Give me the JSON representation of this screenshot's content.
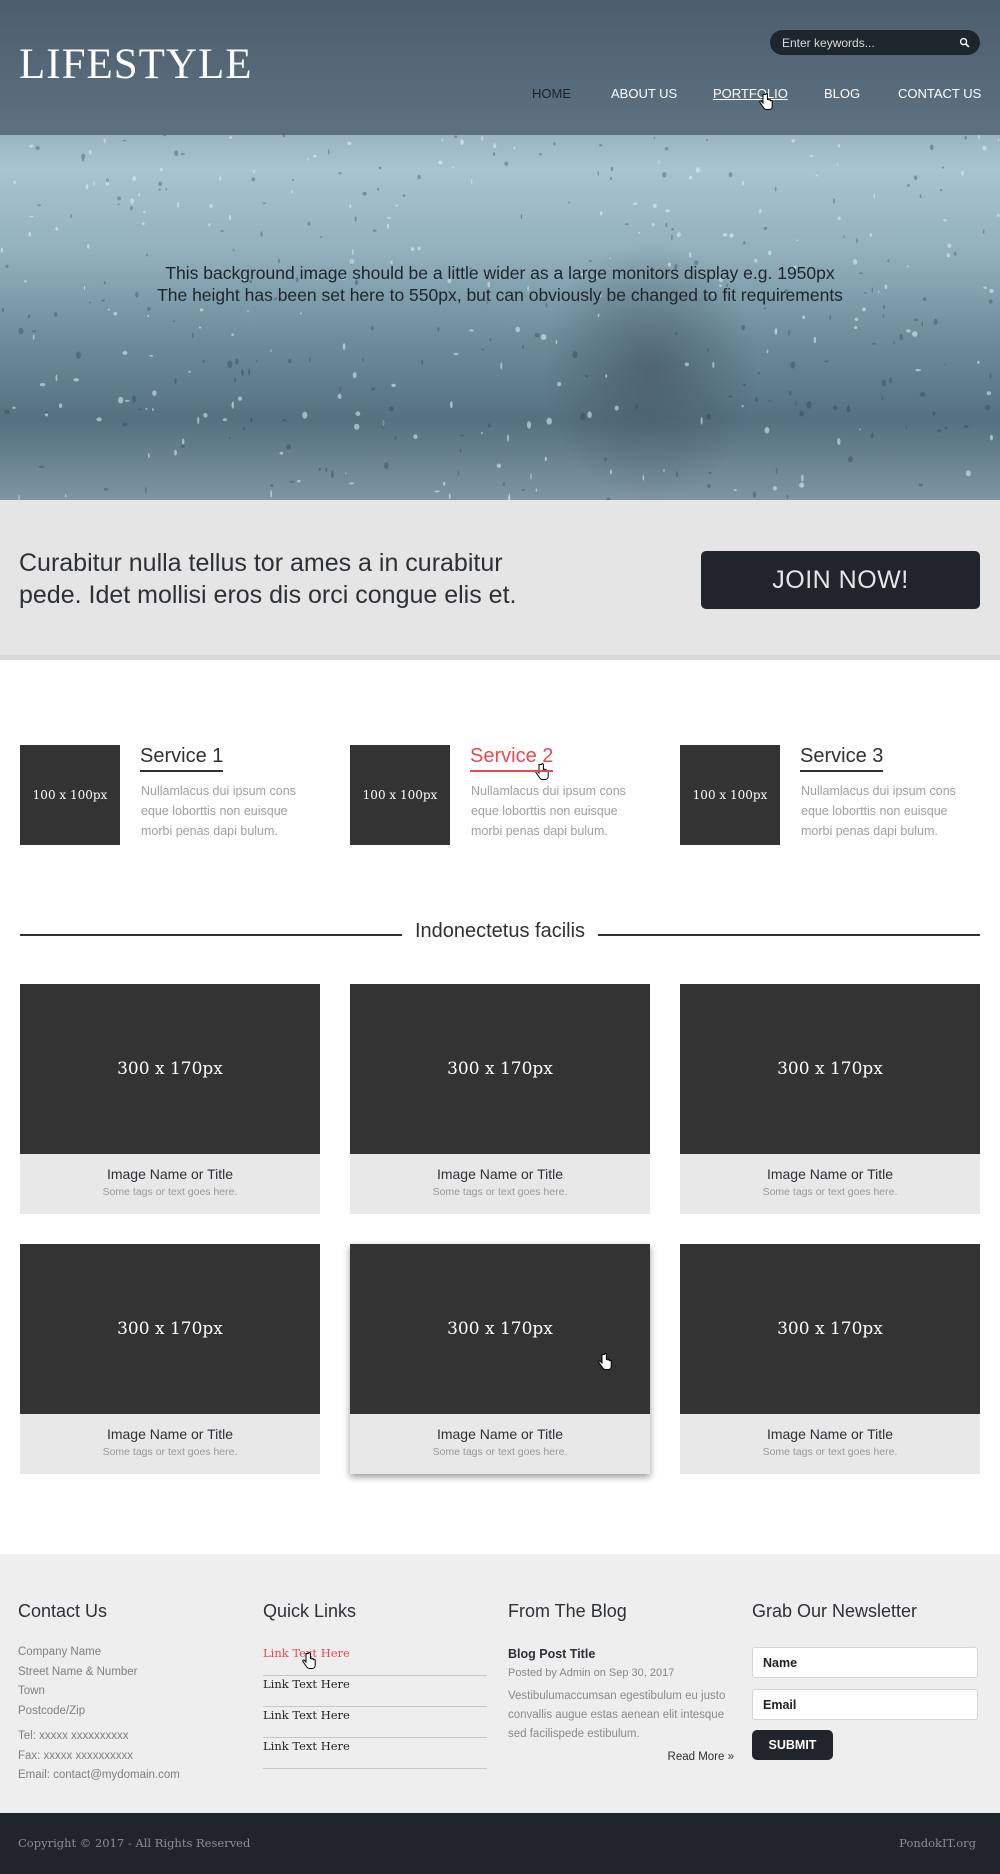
{
  "header": {
    "logo": "LIFESTYLE",
    "search_placeholder": "Enter keywords...",
    "nav": [
      "HOME",
      "ABOUT US",
      "PORTFOLIO",
      "BLOG",
      "CONTACT US"
    ]
  },
  "hero": {
    "line1": "This background image should be a little wider as a large monitors display e.g. 1950px",
    "line2": "The height has been set here to 550px, but can obviously be changed to fit requirements"
  },
  "cta": {
    "text": "Curabitur nulla tellus tor ames a in curabitur pede. Idet mollisi eros dis orci congue elis et.",
    "button": "JOIN NOW!"
  },
  "services": [
    {
      "thumb": "100 x 100px",
      "title": "Service 1",
      "desc": "Nullamlacus dui ipsum cons eque loborttis non euisque morbi penas dapi bulum."
    },
    {
      "thumb": "100 x 100px",
      "title": "Service 2",
      "desc": "Nullamlacus dui ipsum cons eque loborttis non euisque morbi penas dapi bulum."
    },
    {
      "thumb": "100 x 100px",
      "title": "Service 3",
      "desc": "Nullamlacus dui ipsum cons eque loborttis non euisque morbi penas dapi bulum."
    }
  ],
  "gallery": {
    "title": "Indonectetus facilis",
    "items": [
      {
        "image": "300 x 170px",
        "name": "Image Name or Title",
        "tags": "Some tags or text goes here."
      },
      {
        "image": "300 x 170px",
        "name": "Image Name or Title",
        "tags": "Some tags or text goes here."
      },
      {
        "image": "300 x 170px",
        "name": "Image Name or Title",
        "tags": "Some tags or text goes here."
      },
      {
        "image": "300 x 170px",
        "name": "Image Name or Title",
        "tags": "Some tags or text goes here."
      },
      {
        "image": "300 x 170px",
        "name": "Image Name or Title",
        "tags": "Some tags or text goes here."
      },
      {
        "image": "300 x 170px",
        "name": "Image Name or Title",
        "tags": "Some tags or text goes here."
      }
    ]
  },
  "footer": {
    "contact": {
      "heading": "Contact Us",
      "company": "Company Name",
      "street": "Street Name & Number",
      "town": "Town",
      "postcode": "Postcode/Zip",
      "tel": "Tel: xxxxx xxxxxxxxxx",
      "fax": "Fax: xxxxx xxxxxxxxxx",
      "email": "Email: contact@mydomain.com"
    },
    "quick_links": {
      "heading": "Quick Links",
      "links": [
        "Link Text Here",
        "Link Text Here",
        "Link Text Here",
        "Link Text Here"
      ]
    },
    "blog": {
      "heading": "From The Blog",
      "post_title": "Blog Post Title",
      "meta": "Posted by Admin on Sep 30, 2017",
      "excerpt": "Vestibulumaccumsan egestibulum eu justo convallis augue estas aenean elit intesque sed facilispede estibulum.",
      "read_more": "Read More »"
    },
    "newsletter": {
      "heading": "Grab Our Newsletter",
      "name_placeholder": "Name",
      "email_placeholder": "Email",
      "submit": "SUBMIT"
    }
  },
  "bottom_bar": {
    "copyright": "Copyright © 2017 - All Rights Reserved",
    "credit": "PondokIT.org"
  },
  "colors": {
    "accent_red": "#e64951",
    "dark": "#20242b",
    "tile": "#333333",
    "light_gray": "#e5e5e5"
  },
  "icons": [
    "search-icon",
    "hand-cursor-icon"
  ]
}
